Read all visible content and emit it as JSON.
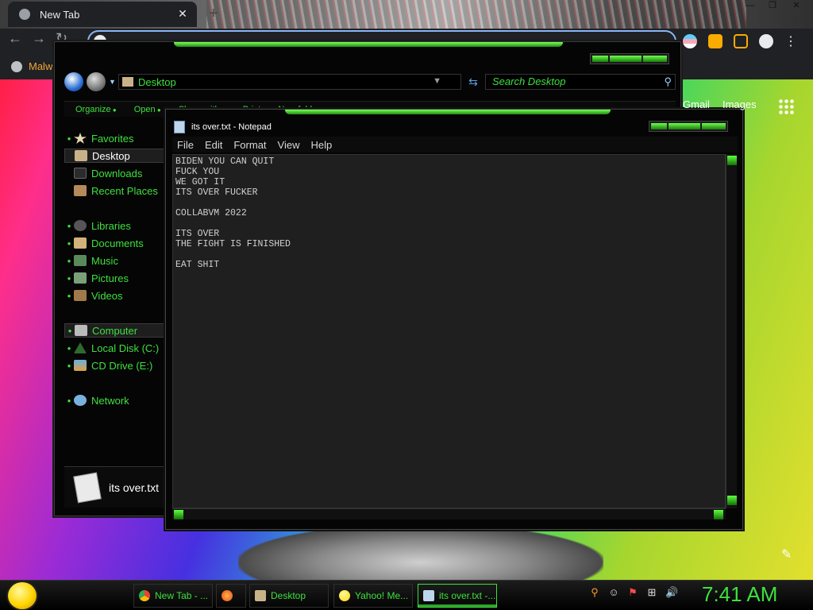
{
  "browser": {
    "tab_title": "New Tab",
    "new_tab_symbol": "+",
    "bookmark_label": "Malwa",
    "google_links": [
      "Gmail",
      "Images"
    ]
  },
  "explorer": {
    "address": "Desktop",
    "search_placeholder": "Search Desktop",
    "toolbar": [
      "Organize",
      "Open",
      "Share with",
      "Print",
      "New folder"
    ],
    "nav_items": [
      {
        "label": "Favorites",
        "icon": "star-icon",
        "header": true
      },
      {
        "label": "Desktop",
        "icon": "desktop-icon",
        "selected": true
      },
      {
        "label": "Downloads",
        "icon": "downloads-icon"
      },
      {
        "label": "Recent Places",
        "icon": "recent-places-icon"
      },
      {
        "label": "Libraries",
        "icon": "libraries-icon",
        "header": true
      },
      {
        "label": "Documents",
        "icon": "documents-icon"
      },
      {
        "label": "Music",
        "icon": "music-icon"
      },
      {
        "label": "Pictures",
        "icon": "pictures-icon"
      },
      {
        "label": "Videos",
        "icon": "videos-icon"
      },
      {
        "label": "Computer",
        "icon": "computer-icon",
        "header": true,
        "selected": true
      },
      {
        "label": "Local Disk (C:)",
        "icon": "local-disk-icon"
      },
      {
        "label": "CD Drive (E:)",
        "icon": "cd-drive-icon"
      },
      {
        "label": "Network",
        "icon": "network-icon",
        "header": true
      }
    ],
    "details_filename": "its over.txt"
  },
  "notepad": {
    "title": "its over.txt - Notepad",
    "menu": [
      "File",
      "Edit",
      "Format",
      "View",
      "Help"
    ],
    "content": "BIDEN YOU CAN QUIT\nFUCK YOU\nWE GOT IT\nITS OVER FUCKER\n\nCOLLABVM 2022\n\nITS OVER\nTHE FIGHT IS FINISHED\n\nEAT SHIT"
  },
  "taskbar": {
    "buttons": [
      {
        "label": "New Tab - ...",
        "icon": "chrome-icon",
        "active": false
      },
      {
        "label": "",
        "icon": "firefox-icon",
        "active": false
      },
      {
        "label": "Desktop",
        "icon": "folder-icon",
        "active": false
      },
      {
        "label": "Yahoo! Me...",
        "icon": "yahoo-messenger-icon",
        "active": false
      },
      {
        "label": "its over.txt -...",
        "icon": "notepad-icon",
        "active": true
      }
    ],
    "clock": "7:41 AM"
  },
  "colors": {
    "accent_green": "#3ee03e",
    "window_bg": "#050505",
    "editor_bg": "#1f1f1f"
  }
}
